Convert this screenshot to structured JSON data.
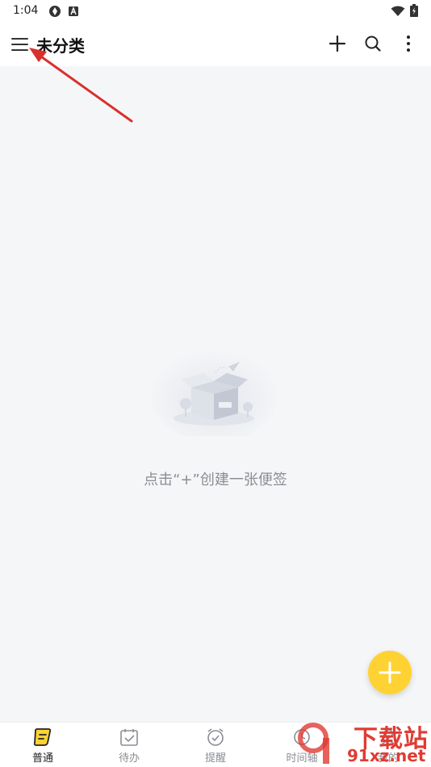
{
  "status_bar": {
    "time": "1:04",
    "icons": [
      "sync-icon",
      "a-badge-icon",
      "wifi-icon",
      "battery-icon"
    ]
  },
  "app_bar": {
    "title": "未分类",
    "actions": [
      "add-icon",
      "search-icon",
      "more-icon"
    ]
  },
  "empty_state": {
    "message": "点击“+”创建一张便签"
  },
  "bottom_nav": {
    "items": [
      {
        "label": "普通",
        "icon": "note-icon",
        "active": true
      },
      {
        "label": "待办",
        "icon": "todo-calendar-icon",
        "active": false
      },
      {
        "label": "提醒",
        "icon": "alarm-clock-icon",
        "active": false
      },
      {
        "label": "时间轴",
        "icon": "timeline-icon",
        "active": false
      },
      {
        "label": "我的",
        "icon": "profile-icon",
        "active": false
      }
    ]
  },
  "colors": {
    "accent": "#ffd233",
    "background": "#f5f6f8",
    "annotation_arrow": "#d9302c"
  },
  "watermark": {
    "text_cn": "下载站",
    "text_en": "91xz.net"
  }
}
